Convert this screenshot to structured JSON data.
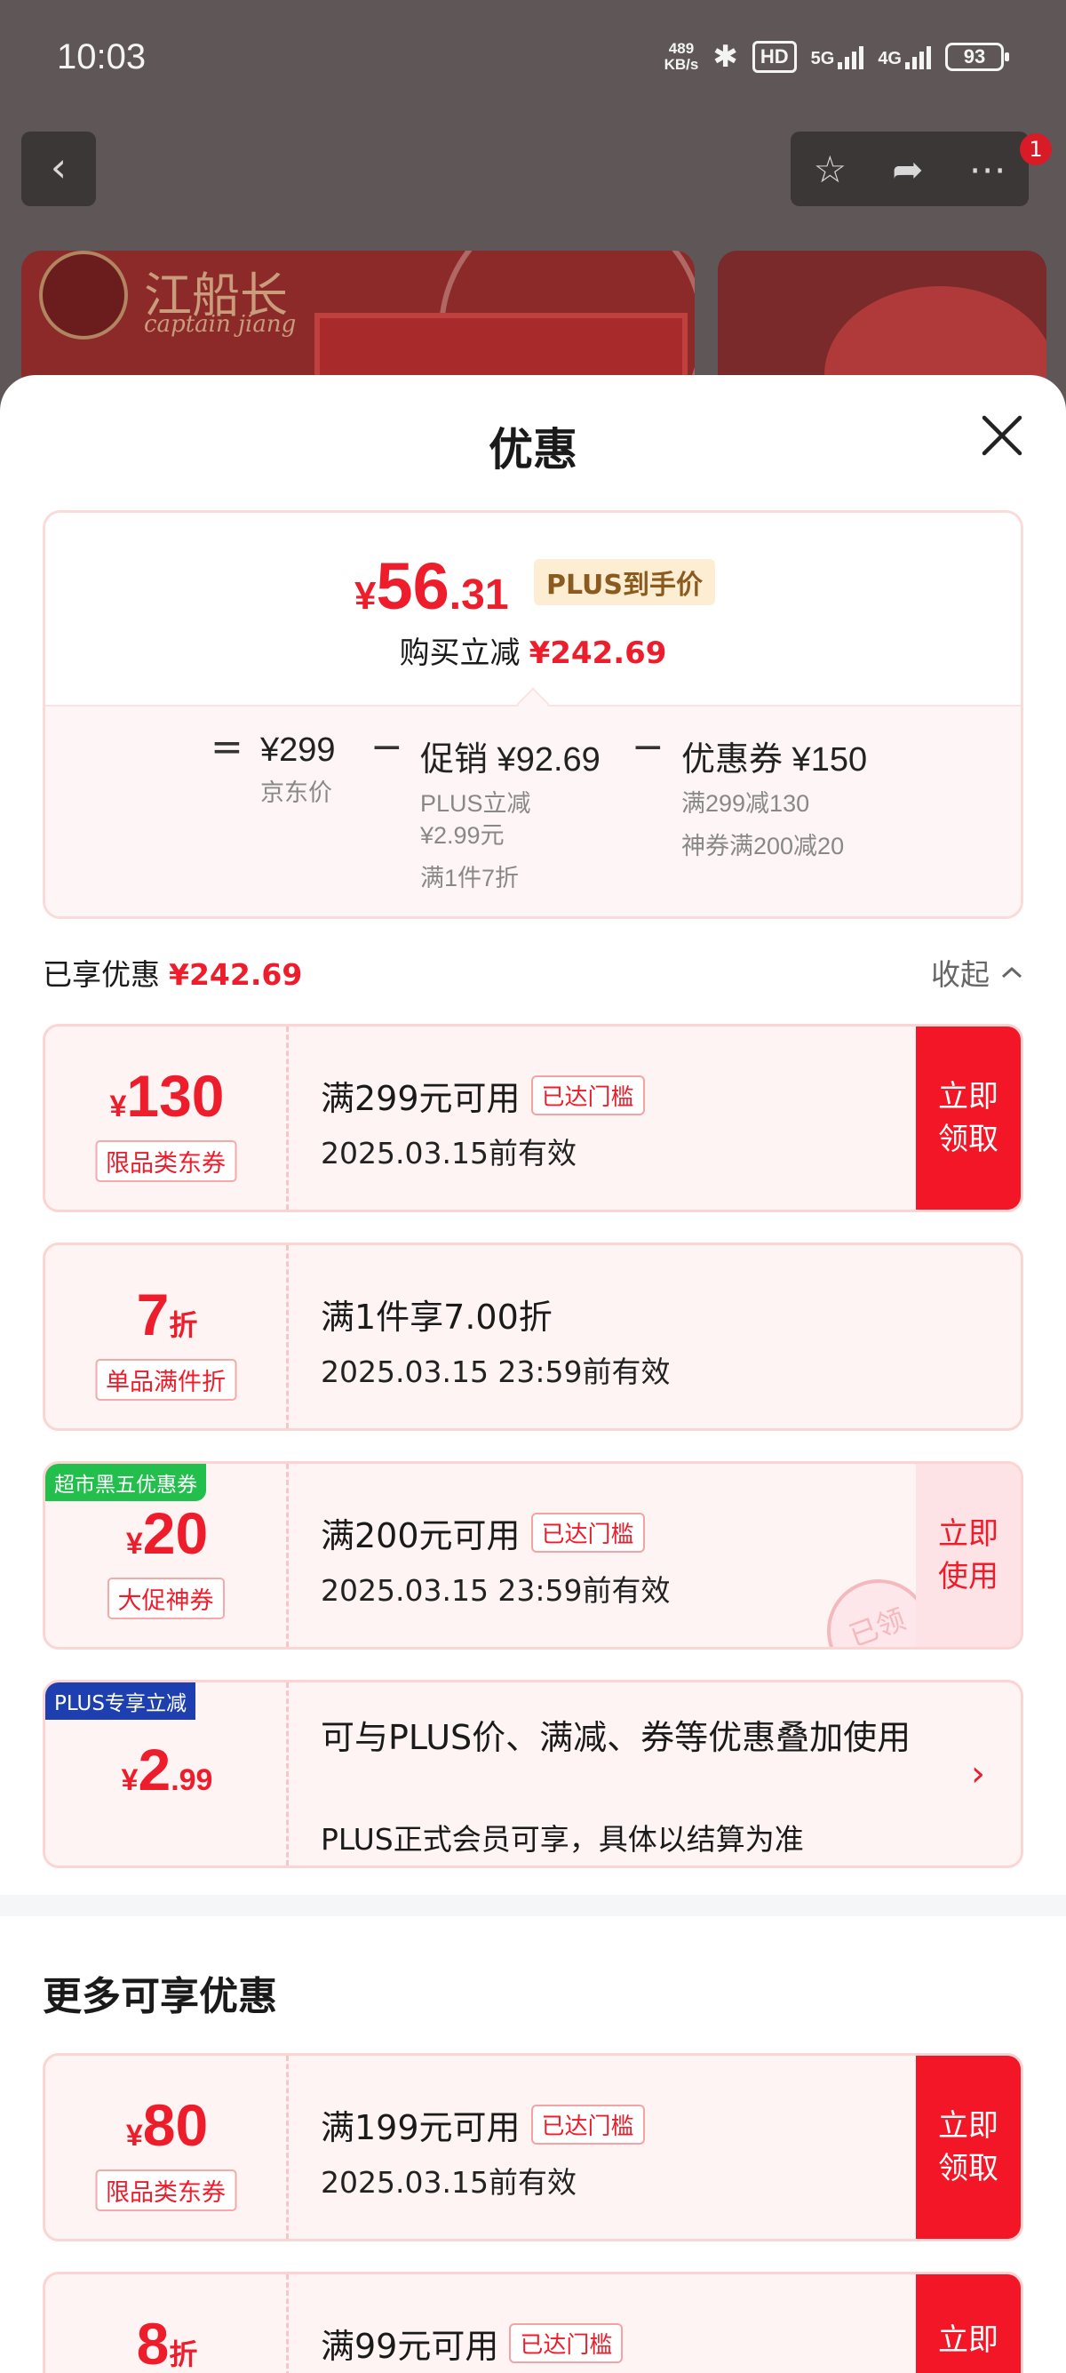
{
  "status_bar": {
    "time": "10:03",
    "netspeed_value": "489",
    "netspeed_unit": "KB/s",
    "hd_label": "HD",
    "sig1_label": "5G",
    "sig2_label": "4G",
    "battery": "93"
  },
  "background": {
    "brand_cn": "江船长",
    "brand_en": "captain jiang",
    "notification_count": "1"
  },
  "sheet": {
    "title": "优惠",
    "summary": {
      "currency": "¥",
      "price_int": "56",
      "price_dec": ".31",
      "plus_tag": "PLUS到手价",
      "reduce_label": "购买立减",
      "reduce_amount": "¥242.69",
      "equals": "=",
      "minus": "−",
      "jd_price": "¥299",
      "jd_price_label": "京东价",
      "promo": "促销 ¥92.69",
      "promo_line1": "PLUS立减",
      "promo_line2": "¥2.99元",
      "promo_line3": "满1件7折",
      "coupon": "优惠券 ¥150",
      "coupon_line1": "满299减130",
      "coupon_line2": "神券满200减20"
    },
    "enjoyed_label": "已享优惠",
    "enjoyed_amount": "¥242.69",
    "collapse_label": "收起",
    "coupons": [
      {
        "currency": "¥",
        "value": "130",
        "type": "限品类东券",
        "title": "满299元可用",
        "tag": "已达门槛",
        "date": "2025.03.15前有效",
        "action": "立即\n领取"
      },
      {
        "value": "7",
        "unit": "折",
        "type": "单品满件折",
        "title": "满1件享7.00折",
        "date": "2025.03.15 23:59前有效"
      },
      {
        "corner": "超市黑五优惠券",
        "currency": "¥",
        "value": "20",
        "type": "大促神券",
        "title": "满200元可用",
        "tag": "已达门槛",
        "date": "2025.03.15 23:59前有效",
        "action": "立即\n使用",
        "stamp": "已领"
      },
      {
        "corner": "PLUS专享立减",
        "currency": "¥",
        "value": "2",
        "dec": ".99",
        "title": "可与PLUS价、满减、券等优惠叠加使用",
        "note": "PLUS正式会员可享，具体以结算为准"
      }
    ],
    "more_title": "更多可享优惠",
    "more_coupons": [
      {
        "currency": "¥",
        "value": "80",
        "type": "限品类东券",
        "title": "满199元可用",
        "tag": "已达门槛",
        "date": "2025.03.15前有效",
        "action": "立即\n领取"
      },
      {
        "value": "8",
        "unit": "折",
        "title": "满99元可用",
        "tag": "已达门槛",
        "action": "立即"
      }
    ]
  }
}
